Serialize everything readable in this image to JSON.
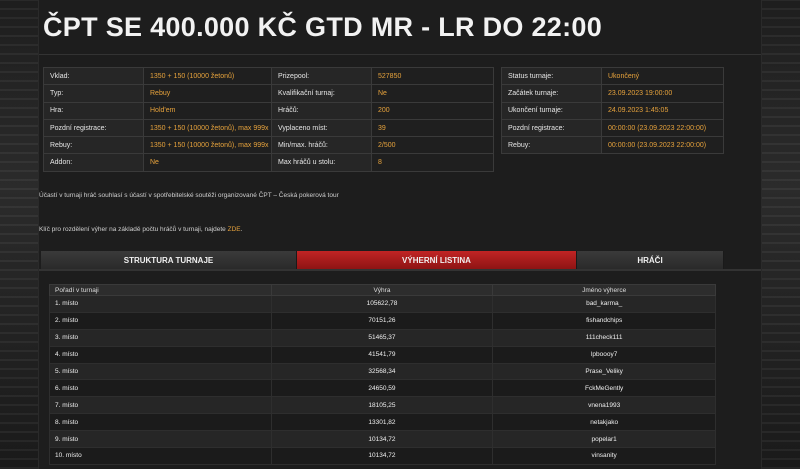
{
  "page_title": "ČPT SE 400.000 KČ GTD MR - LR DO 22:00",
  "col1": [
    {
      "k": "Vklad:",
      "v": "1350 + 150 (10000 žetonů)"
    },
    {
      "k": "Typ:",
      "v": "Rebuy"
    },
    {
      "k": "Hra:",
      "v": "Hold'em"
    },
    {
      "k": "Pozdní registrace:",
      "v": "1350 + 150 (10000 žetonů), max 999x"
    },
    {
      "k": "Rebuy:",
      "v": "1350 + 150 (10000 žetonů), max 999x"
    },
    {
      "k": "Addon:",
      "v": "Ne"
    }
  ],
  "col2": [
    {
      "k": "Prizepool:",
      "v": "527850"
    },
    {
      "k": "Kvalifikační turnaj:",
      "v": "Ne"
    },
    {
      "k": "Hráčů:",
      "v": "200"
    },
    {
      "k": "Vyplaceno míst:",
      "v": "39"
    },
    {
      "k": "Min/max. hráčů:",
      "v": "2/500"
    },
    {
      "k": "Max hráčů u stolu:",
      "v": "8"
    }
  ],
  "col3": [
    {
      "k": "Status turnaje:",
      "v": "Ukončený"
    },
    {
      "k": "Začátek turnaje:",
      "v": "23.09.2023 19:00:00"
    },
    {
      "k": "Ukončení turnaje:",
      "v": "24.09.2023 1:45:05"
    },
    {
      "k": "Pozdní registrace:",
      "v": "00:00:00 (23.09.2023 22:00:00)"
    },
    {
      "k": "Rebuy:",
      "v": "00:00:00 (23.09.2023 22:00:00)"
    }
  ],
  "note1": "Účastí v turnaji hráč souhlasí s účastí v spotřebitelské soutěži organizované ČPT – Česká pokerová tour",
  "note2": {
    "text": "Klíč pro rozdělení výher na základě počtu hráčů v turnaji, najdete",
    "link": "ZDE",
    "end": "."
  },
  "tabs": [
    "STRUKTURA TURNAJE",
    "VÝHERNÍ LISTINA",
    "HRÁČI"
  ],
  "active_tab": 1,
  "prize_headers": [
    "Pořadí v turnaji",
    "Výhra",
    "Jméno výherce"
  ],
  "prize_rows": [
    [
      "1. místo",
      "105622,78",
      "bad_karma_"
    ],
    [
      "2. místo",
      "70151,26",
      "fishandchips"
    ],
    [
      "3. místo",
      "51465,37",
      "111check111"
    ],
    [
      "4. místo",
      "41541,79",
      "lpbooоy7"
    ],
    [
      "5. místo",
      "32568,34",
      "Prase_Veliky"
    ],
    [
      "6. místo",
      "24650,59",
      "FckMeGently"
    ],
    [
      "7. místo",
      "18105,25",
      "vnena1993"
    ],
    [
      "8. místo",
      "13301,82",
      "netakjako"
    ],
    [
      "9. místo",
      "10134,72",
      "popelar1"
    ],
    [
      "10. místo",
      "10134,72",
      "vinsanity"
    ]
  ]
}
